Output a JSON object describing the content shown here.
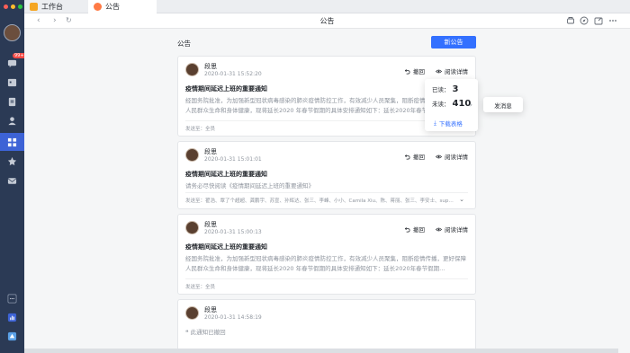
{
  "window": {
    "traffic_lights": [
      "#ff5f57",
      "#febc2e",
      "#28c840"
    ]
  },
  "sidebar": {
    "badge": "99+",
    "icons": [
      "message-icon",
      "calendar-icon",
      "docs-icon",
      "contacts-icon",
      "workplace-icon",
      "favorites-icon",
      "mail-icon",
      "more-icon",
      "stats-icon",
      "app-icon"
    ]
  },
  "tabs": [
    {
      "label": "工作台",
      "icon": "workplace-icon"
    },
    {
      "label": "公告",
      "icon": "announcement-icon"
    }
  ],
  "nav": {
    "title": "公告"
  },
  "page": {
    "title": "公告",
    "new_button": "新公告"
  },
  "actions": {
    "withdraw": "撤回",
    "read_details": "阅读详情"
  },
  "cards": [
    {
      "name": "段思",
      "time": "2020-01-31 15:52:20",
      "title": "疫情期间延迟上班的重要通知",
      "body": "经国务院批准，为加强新型冠状病毒感染的肺炎疫情防控工作，有效减少人员聚集，阻断疫情传播，更好保障人民群众生命和身体健康，现将延长2020 年春节假期的具体安排通知如下：延长2020年春节假期...",
      "recipients": "发送至：全员"
    },
    {
      "name": "段思",
      "time": "2020-01-31 15:01:01",
      "title": "疫情期间延迟上班的重要通知",
      "body": "请务必尽快阅读《疫情期间延迟上班的重要通知》",
      "recipients": "发送至：翟浩、覃了个超超、龚鹏宇、苏宣、孙辉达、张三、李峰、小小、Camila Xiu、陈、蒋丽、张三、李安士、supe..."
    },
    {
      "name": "段思",
      "time": "2020-01-31 15:00:13",
      "title": "疫情期间延迟上班的重要通知",
      "body": "经国务院批准，为加强新型冠状病毒感染的肺炎疫情防控工作，有效减少人员聚集，阻断疫情传播，更好保障人民群众生命和身体健康，现将延长2020 年春节假期的具体安排通知如下：延长2020年春节假期...",
      "recipients": "发送至：全员"
    },
    {
      "name": "段思",
      "time": "2020-01-31 14:58:19",
      "quote": "此通知已撤回"
    }
  ],
  "popover": {
    "read_label": "已读：",
    "read_count": "3",
    "unread_label": "未读：",
    "unread_count": "410",
    "download": "下载表格",
    "send_message": "发消息"
  },
  "colors": {
    "accent": "#3370ff",
    "rail": "#2b3a55",
    "rail_active": "#3d63d6"
  }
}
